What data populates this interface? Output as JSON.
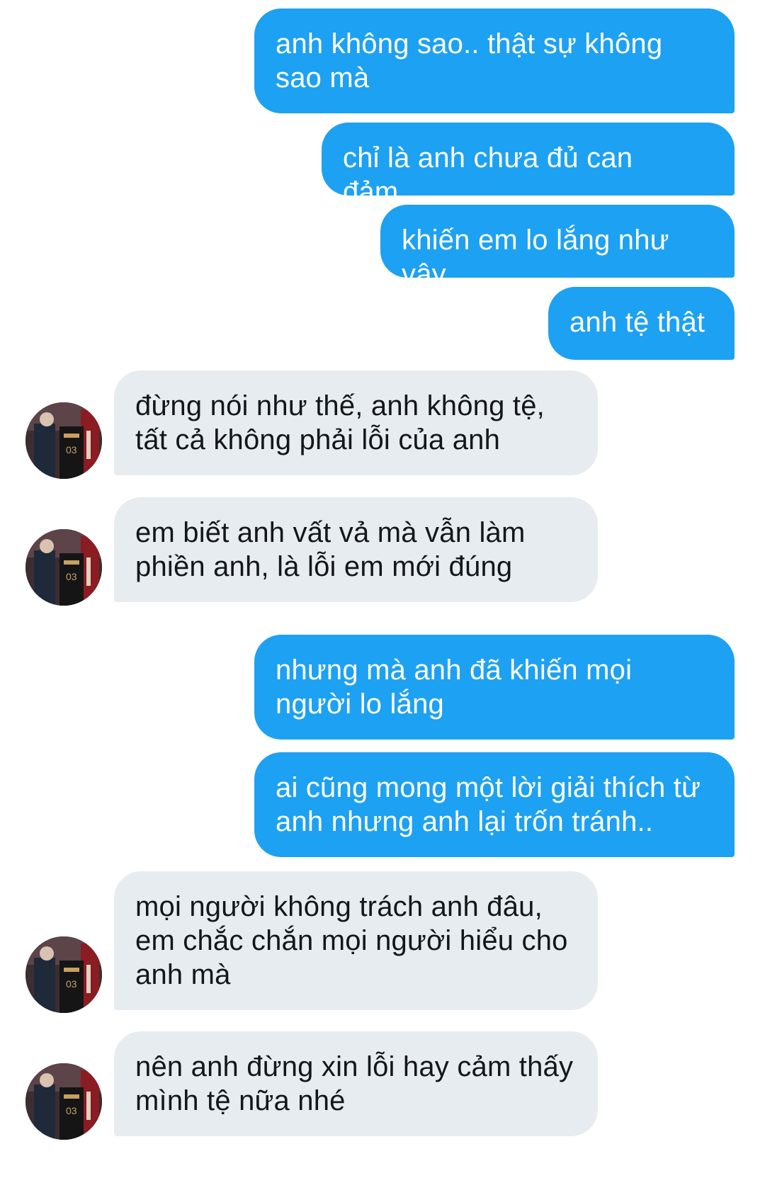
{
  "conversation": {
    "messages": [
      {
        "sender": "me",
        "text": "anh không sao.. thật sự không sao mà"
      },
      {
        "sender": "me",
        "text": "chỉ là anh chưa đủ can đảm..."
      },
      {
        "sender": "me",
        "text": "khiến em lo lắng như vậy"
      },
      {
        "sender": "me",
        "text": "anh tệ thật"
      },
      {
        "sender": "other",
        "text": "đừng nói như thế, anh không tệ, tất cả không phải lỗi của anh"
      },
      {
        "sender": "other",
        "text": "em biết anh vất vả mà vẫn làm phiền anh, là lỗi em mới đúng"
      },
      {
        "sender": "me",
        "text": "nhưng mà anh đã khiến mọi người lo lắng"
      },
      {
        "sender": "me",
        "text": "ai cũng mong một lời giải thích từ anh nhưng anh lại trốn tránh.."
      },
      {
        "sender": "other",
        "text": "mọi người không trách anh đâu, em chắc chắn mọi người hiểu cho anh mà"
      },
      {
        "sender": "other",
        "text": "nên anh đừng xin lỗi hay cảm thấy mình tệ nữa nhé"
      }
    ]
  },
  "colors": {
    "sent_bubble": "#1da1f2",
    "sent_text": "#ffffff",
    "received_bubble": "#e6ecf0",
    "received_text": "#14171a",
    "background": "#ffffff"
  },
  "icons": {
    "avatar": "profile-photo-avatar"
  }
}
